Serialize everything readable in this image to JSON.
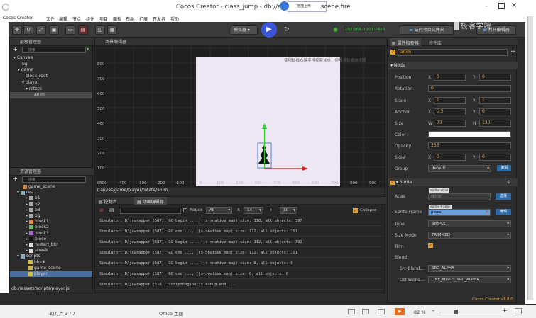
{
  "title_bar": {
    "app_title": "Cocos Creator - class_jump - db://assets/sce",
    "title_suffix": "scene.fire",
    "upload_tooltip": "拖拽上传",
    "wifi_ip": "192.168.0.101:7456"
  },
  "menu": [
    "Cocos Creator",
    "文件",
    "编辑",
    "节点",
    "组件",
    "项目",
    "面板",
    "布局",
    "扩展",
    "开发者",
    "帮助"
  ],
  "toolbar": {
    "platform_select": "模拟器",
    "open_project_label": "访问项目文件夹",
    "open_editor_label": "打开编辑器",
    "watermark_text": "极客学院"
  },
  "hierarchy": {
    "title": "层级管理器",
    "search_placeholder": "搜索",
    "nodes": [
      "Canvas",
      "bg",
      "game",
      "block_root",
      "player",
      "rotate",
      "anim"
    ]
  },
  "assets": {
    "title": "资源管理器",
    "search_placeholder": "搜索",
    "items": [
      "game_scene",
      "res",
      "b1",
      "b2",
      "b3",
      "bg",
      "block1",
      "block2",
      "block3",
      "piece",
      "restart_btn",
      "streak",
      "scripts",
      "block",
      "game_scene",
      "player"
    ],
    "footer_path": "db://assets/scripts/player.js"
  },
  "scene": {
    "title": "场景编辑器",
    "hint": "使用鼠标右键平移视窗焦点，使用滚轮缩放视图",
    "y_ticks": [
      "800",
      "700",
      "600",
      "500",
      "400",
      "300",
      "200",
      "100",
      "0"
    ],
    "x_ticks": [
      "-500",
      "-400",
      "-300",
      "-200",
      "-100",
      "0",
      "100",
      "200",
      "300",
      "400",
      "500",
      "600",
      "700",
      "800",
      "900"
    ],
    "breadcrumb": "Canvas/game/player/rotate/anim"
  },
  "console": {
    "tab_console": "控制台",
    "tab_animation": "动画编辑器",
    "regex_label": "Regex",
    "level_select": "All",
    "font_size": "14",
    "line_height": "30",
    "collapse_label": "Collapse",
    "logs": [
      "Simulator: D/jswrapper (587): GC begin ..., (js->native map) size: 118, all objects: 397",
      "Simulator: D/jswrapper (587): GC end ..., (js->native map) size: 112, all objects: 391",
      "Simulator: D/jswrapper (587): GC begin ..., (js->native map) size: 112, all objects: 391",
      "Simulator: D/jswrapper (587): GC end ..., (js->native map) size: 112, all objects: 391",
      "Simulator: D/jswrapper (587): GC begin ..., (js->native map) size: 0, all objects: 0",
      "Simulator: D/jswrapper (587): GC end ..., (js->native map) size: 0, all objects: 0",
      "Simulator: D/jswrapper (510): ScriptEngine::cleanup end ..."
    ]
  },
  "inspector": {
    "tab_props": "属性检查器",
    "tab_controls": "控件库",
    "node_name": "anim",
    "node_section": "Node",
    "labels": {
      "position": "Position",
      "rotation": "Rotation",
      "scale": "Scale",
      "anchor": "Anchor",
      "size": "Size",
      "color": "Color",
      "opacity": "Opacity",
      "skew": "Skew",
      "group": "Group"
    },
    "axes": {
      "x": "X",
      "y": "Y",
      "w": "W",
      "h": "H"
    },
    "values": {
      "pos_x": "0",
      "pos_y": "0",
      "rotation": "0",
      "scale_x": "1",
      "scale_y": "1",
      "anchor_x": "0.5",
      "anchor_y": "0",
      "width": "73",
      "height": "130",
      "opacity": "255",
      "skew_x": "0",
      "skew_y": "0",
      "group": "default"
    },
    "edit_label": "编辑",
    "sprite_section": "Sprite",
    "sprite_labels": {
      "atlas": "Atlas",
      "sprite_frame": "Sprite Frame",
      "type": "Type",
      "size_mode": "Size Mode",
      "trim": "Trim",
      "blend": "Blend",
      "src_blend": "Src Blend...",
      "dst_blend": "Dst Blend..."
    },
    "atlas_tag": "sprite-atlas",
    "atlas_value": "None",
    "atlas_button": "选择",
    "frame_tag": "sprite-frame",
    "frame_value": "piece",
    "frame_button": "编辑",
    "type_value": "SIMPLE",
    "size_mode_value": "TRIMMED",
    "src_blend_value": "SRC_ALPHA",
    "dst_blend_value": "ONE_MINUS_SRC_ALPHA",
    "version": "Cocos Creator v1.8.0"
  },
  "statusbar": {
    "slide": "幻灯片 3 / 7",
    "theme": "Office 主题",
    "zoom": "82 %"
  },
  "colors": {
    "accent_orange": "#e6a030",
    "selection_blue": "#4a6fa0",
    "play_blue": "#3d55d8"
  }
}
